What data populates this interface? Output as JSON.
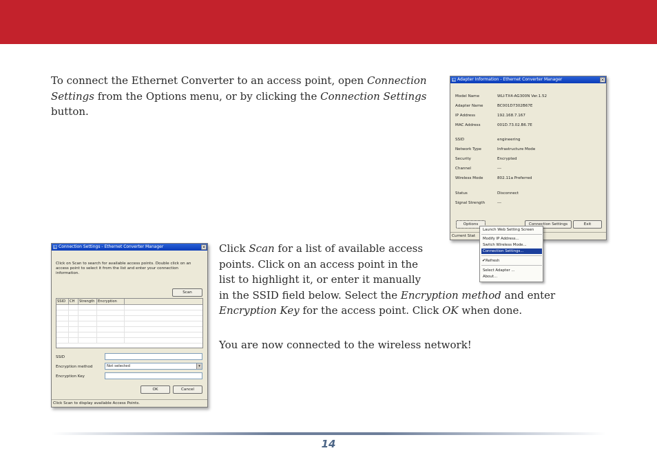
{
  "paragraphs": {
    "p1": [
      "To connect the Ethernet Converter to an access point, open ",
      "Connection Settings",
      " from the Options menu, or by clicking the ",
      "Connection Settings",
      " button."
    ],
    "p2": [
      "Click ",
      "Scan",
      " for a list of available access points.  Click on an access point in the list to highlight it, or enter it manually in the SSID field below.  Select the ",
      "Encryption method",
      " and enter ",
      "Encryption Key",
      " for the access point.  Click ",
      "OK",
      " when done."
    ],
    "p3": "You are now connected to the wireless network!"
  },
  "adapter_window": {
    "title": "Adapter Information - Ethernet Converter Manager",
    "close": "×",
    "rows": [
      {
        "k": "Model Name",
        "v": "WLI-TX4-AG300N Ver.1.52"
      },
      {
        "k": "Adapter Name",
        "v": "BC001D7302B67E"
      },
      {
        "k": "IP Address",
        "v": "192.168.7.167"
      },
      {
        "k": "MAC Address",
        "v": "001D.73.02.B6.7E"
      },
      {
        "k": "SSID",
        "v": "engineering"
      },
      {
        "k": "Network Type",
        "v": "Infrastructure Mode"
      },
      {
        "k": "Security",
        "v": "Encrypted"
      },
      {
        "k": "Channel",
        "v": "---"
      },
      {
        "k": "Wireless Mode",
        "v": "802.11a Preferred"
      },
      {
        "k": "Status",
        "v": "Disconnect"
      },
      {
        "k": "Signal Strength",
        "v": "---"
      }
    ],
    "buttons": {
      "options": "Options",
      "connection_settings": "Connection Settings",
      "exit": "Exit"
    },
    "status": "Current Stat"
  },
  "options_menu": {
    "items": [
      "Launch Web Setting Screen",
      "Modify IP Address...",
      "Switch Wireless Mode...",
      "Connection Settings...",
      "Refresh",
      "Select Adapter ...",
      "About..."
    ],
    "check": "✔"
  },
  "conn_window": {
    "title": "Connection Settings - Ethernet Converter Manager",
    "close": "×",
    "instructions": "Click on Scan to search for available access points. Double click on an access point to select it from the list and enter your connection information.",
    "scan": "Scan",
    "columns": [
      "SSID",
      "CH",
      "Strength",
      "Encryption"
    ],
    "labels": {
      "ssid": "SSID",
      "enc_method": "Encryption method",
      "enc_key": "Encryption Key"
    },
    "fields": {
      "ssid": "",
      "enc_method": "Not selected",
      "enc_key": ""
    },
    "dd_arrow": "▾",
    "ok": "OK",
    "cancel": "Cancel",
    "status": "Click Scan to display available Access Points."
  },
  "page_number": "14",
  "colors": {
    "banner": "#c3222c",
    "title_blue": "#0a3bb8",
    "page_number": "#4d6687"
  }
}
